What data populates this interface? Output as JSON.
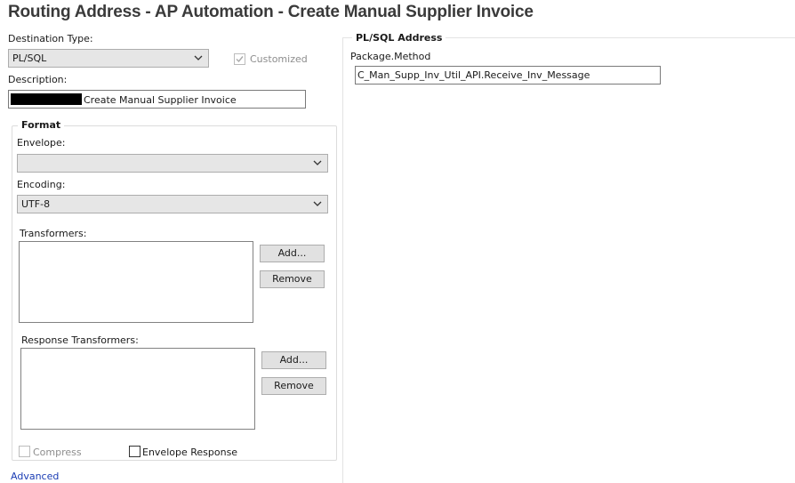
{
  "title": "Routing Address - AP Automation - Create Manual Supplier Invoice",
  "left": {
    "destination_type_label": "Destination Type:",
    "destination_type_value": "PL/SQL",
    "customized_label": "Customized",
    "customized_checked": true,
    "description_label": "Description:",
    "description_value": "Create Manual Supplier Invoice"
  },
  "format": {
    "group_title": "Format",
    "envelope_label": "Envelope:",
    "envelope_value": "",
    "encoding_label": "Encoding:",
    "encoding_value": "UTF-8",
    "transformers_label": "Transformers:",
    "transformers_add": "Add...",
    "transformers_remove": "Remove",
    "response_transformers_label": "Response Transformers:",
    "response_add": "Add...",
    "response_remove": "Remove",
    "compress_label": "Compress",
    "envelope_response_label": "Envelope Response"
  },
  "advanced_link": "Advanced",
  "plsql": {
    "group_title": "PL/SQL Address",
    "package_method_label": "Package.Method",
    "package_method_value": "C_Man_Supp_Inv_Util_API.Receive_Inv_Message"
  },
  "icons": {
    "dropdown": "chevron-down-icon",
    "check": "checkmark-icon"
  }
}
